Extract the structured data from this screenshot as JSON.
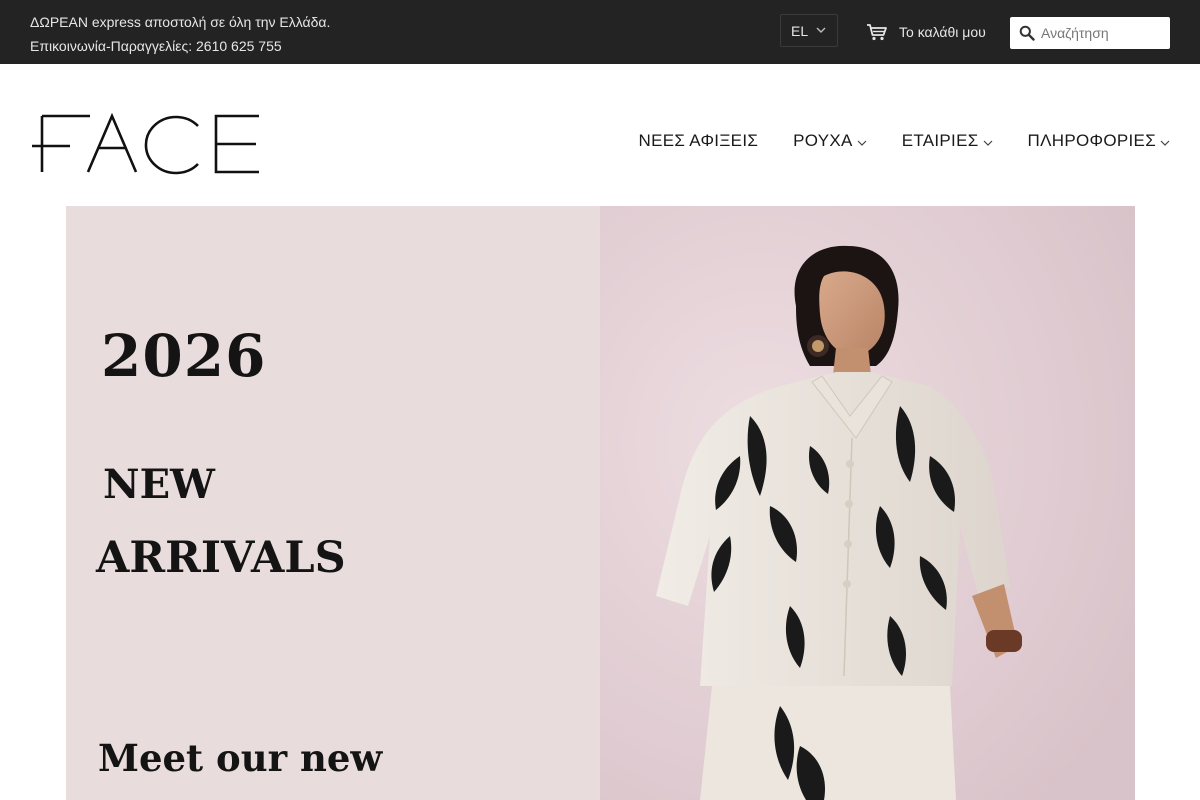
{
  "topbar": {
    "announcement_line1": "ΔΩΡΕΑΝ express αποστολή σε όλη την Ελλάδα.",
    "announcement_line2": "Επικοινωνία-Παραγγελίες: 2610 625 755",
    "language": "EL",
    "cart_label": "Το καλάθι μου",
    "search_placeholder": "Αναζήτηση"
  },
  "header": {
    "logo_text": "FACE",
    "nav": [
      {
        "label": "ΝΕΕΣ ΑΦΙΞΕΙΣ",
        "has_dropdown": false
      },
      {
        "label": "ΡΟΥΧΑ",
        "has_dropdown": true
      },
      {
        "label": "ΕΤΑΙΡΙΕΣ",
        "has_dropdown": true
      },
      {
        "label": "ΠΛΗΡΟΦΟΡΙΕΣ",
        "has_dropdown": true
      }
    ]
  },
  "hero": {
    "year": "2026",
    "line_new": "NEW",
    "line_arrivals": "ARRIVALS",
    "line_meet": "Meet our new",
    "left_bg": "#e8dcdc",
    "right_bg": "#e6d6db"
  },
  "colors": {
    "topbar_bg": "#232323",
    "topbar_text": "#e6e6e6",
    "nav_text": "#1a1a1a"
  }
}
